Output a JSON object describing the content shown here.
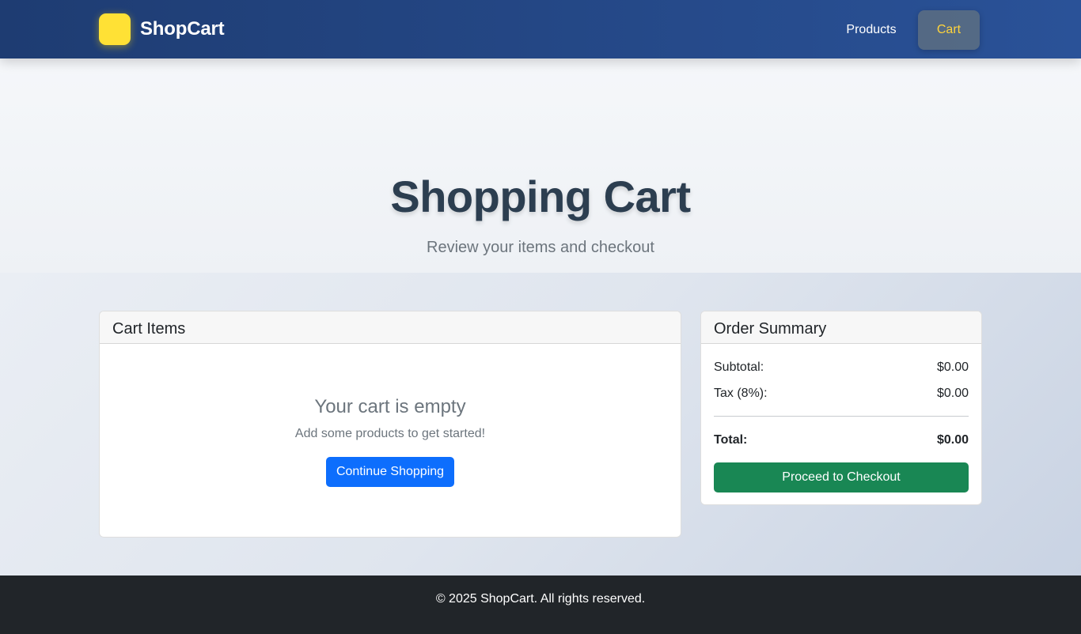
{
  "navbar": {
    "brand": "ShopCart",
    "logo_color": "#ffe135",
    "links": {
      "products": "Products",
      "cart": "Cart"
    },
    "active_link": "Cart",
    "active_color": "#ffd43b"
  },
  "hero": {
    "title": "Shopping Cart",
    "subtitle": "Review your items and checkout",
    "accent_color": "#0d6efd"
  },
  "cart": {
    "header": "Cart Items",
    "empty_title": "Your cart is empty",
    "empty_message": "Add some products to get started!",
    "continue_button": "Continue Shopping"
  },
  "summary": {
    "header": "Order Summary",
    "subtotal_label": "Subtotal:",
    "subtotal_value": "$0.00",
    "tax_label": "Tax (8%):",
    "tax_value": "$0.00",
    "total_label": "Total:",
    "total_value": "$0.00",
    "checkout_button": "Proceed to Checkout",
    "checkout_color": "#198754"
  },
  "footer": {
    "text": "© 2025 ShopCart. All rights reserved."
  }
}
